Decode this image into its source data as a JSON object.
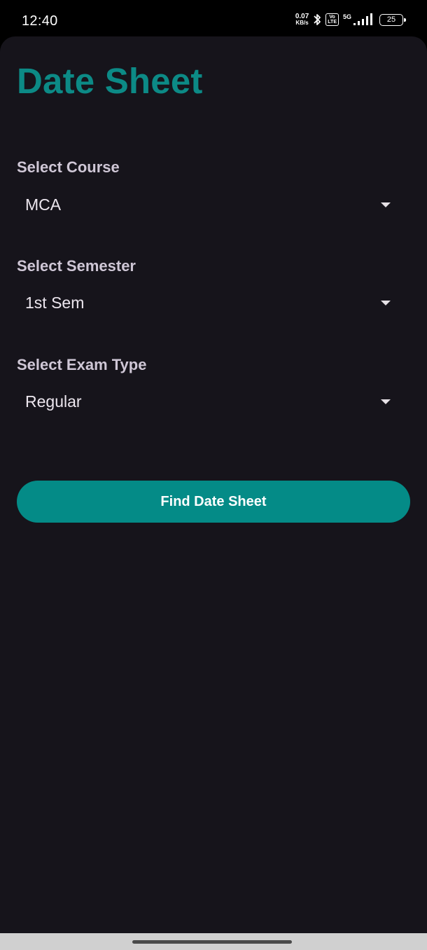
{
  "status_bar": {
    "time": "12:40",
    "net_speed_value": "0.07",
    "net_speed_unit": "KB/s",
    "volte_top": "Vo",
    "volte_bottom": "LTE",
    "network_type": "5G",
    "battery_level": "25",
    "icons": [
      "bluetooth-icon",
      "volte-icon",
      "signal-icon",
      "battery-icon"
    ]
  },
  "page": {
    "title": "Date Sheet",
    "accent_color": "#0c8a86",
    "background_color": "#16141b"
  },
  "form": {
    "course": {
      "label": "Select Course",
      "value": "MCA"
    },
    "semester": {
      "label": "Select Semester",
      "value": "1st Sem"
    },
    "exam_type": {
      "label": "Select Exam Type",
      "value": "Regular"
    },
    "submit_label": "Find Date Sheet"
  }
}
